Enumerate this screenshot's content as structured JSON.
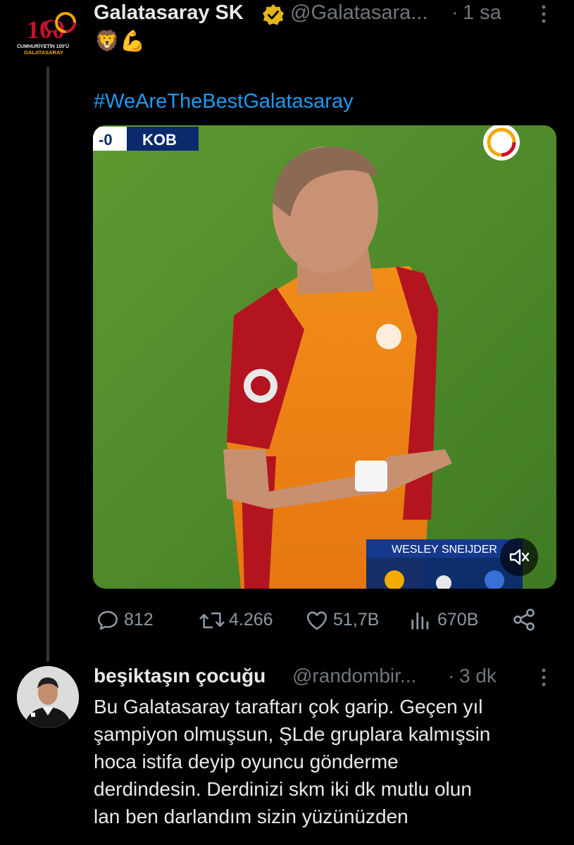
{
  "tweet": {
    "author_name": "Galatasaray SK",
    "handle": "@Galatasara...",
    "separator": "·",
    "time": "1 sa",
    "logo_text_top": "100",
    "logo_text_line1": "CUMHURİYETİN 100'Ü",
    "logo_text_line2": "GALATASARAY",
    "emojis": "🦁💪",
    "hashtag": "#WeAreTheBestGalatasaray",
    "video": {
      "scoreboard_score": "-0",
      "scoreboard_team": "KOB",
      "player_caption": "WESLEY SNEIJDER",
      "muted": true
    },
    "stats": {
      "replies": "812",
      "retweets": "4.266",
      "likes": "51,7B",
      "views": "670B"
    }
  },
  "reply": {
    "author_name": "beşiktaşın çocuğu",
    "handle": "@randombir...",
    "separator": "·",
    "time": "3 dk",
    "lines": [
      "Bu Galatasaray taraftarı çok garip. Geçen yıl",
      "şampiyon olmuşsun, ŞLde gruplara kalmışsin",
      "hoca istifa deyip oyuncu gönderme",
      "derdindesin. Derdinizi skm iki dk mutlu olun",
      "lan ben darlandım sizin yüzünüzden"
    ]
  },
  "colors": {
    "background": "#000000",
    "text": "#e7e9ea",
    "muted": "#71767b",
    "link": "#1d9bf0",
    "verified": "#e2b719",
    "pitch": "#4f8a2b"
  }
}
